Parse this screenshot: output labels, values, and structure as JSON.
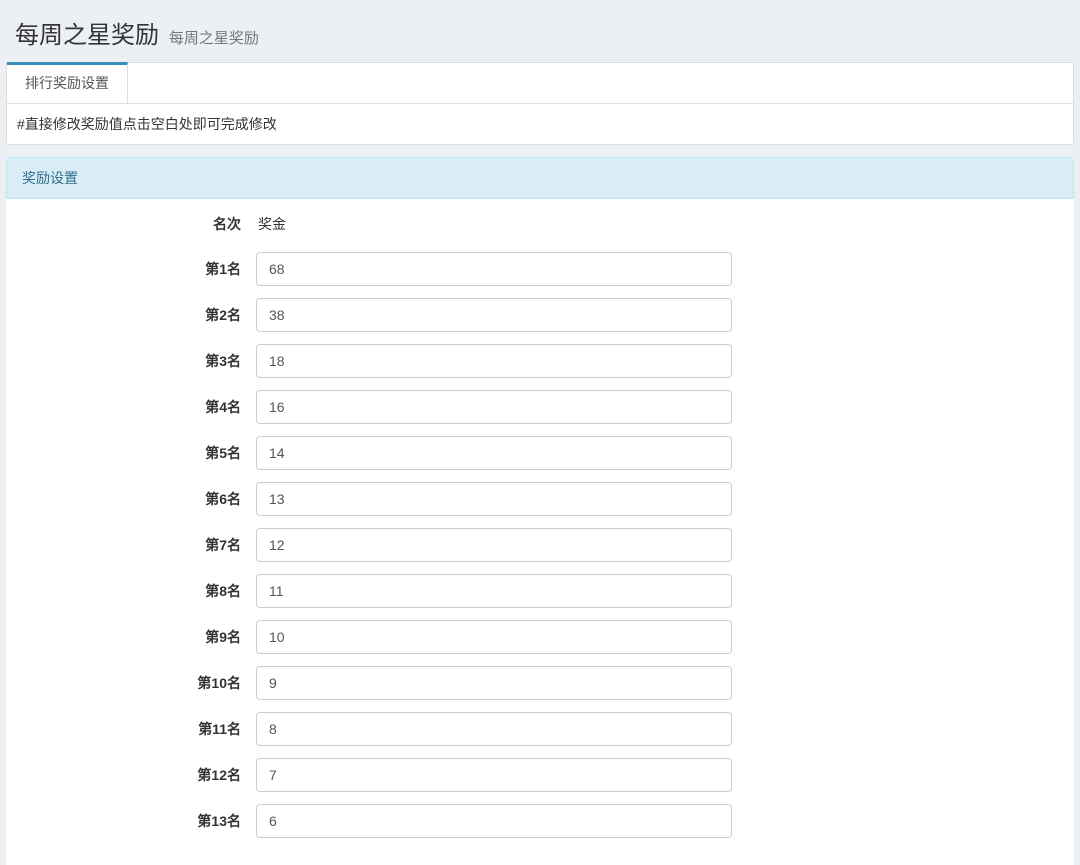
{
  "header": {
    "title": "每周之星奖励",
    "subtitle": "每周之星奖励"
  },
  "tabs": [
    {
      "label": "排行奖励设置"
    }
  ],
  "hint": "#直接修改奖励值点击空白处即可完成修改",
  "panel": {
    "title": "奖励设置"
  },
  "columns": {
    "rank": "名次",
    "reward": "奖金"
  },
  "rows": [
    {
      "label": "第1名",
      "value": "68"
    },
    {
      "label": "第2名",
      "value": "38"
    },
    {
      "label": "第3名",
      "value": "18"
    },
    {
      "label": "第4名",
      "value": "16"
    },
    {
      "label": "第5名",
      "value": "14"
    },
    {
      "label": "第6名",
      "value": "13"
    },
    {
      "label": "第7名",
      "value": "12"
    },
    {
      "label": "第8名",
      "value": "11"
    },
    {
      "label": "第9名",
      "value": "10"
    },
    {
      "label": "第10名",
      "value": "9"
    },
    {
      "label": "第11名",
      "value": "8"
    },
    {
      "label": "第12名",
      "value": "7"
    },
    {
      "label": "第13名",
      "value": "6"
    }
  ]
}
